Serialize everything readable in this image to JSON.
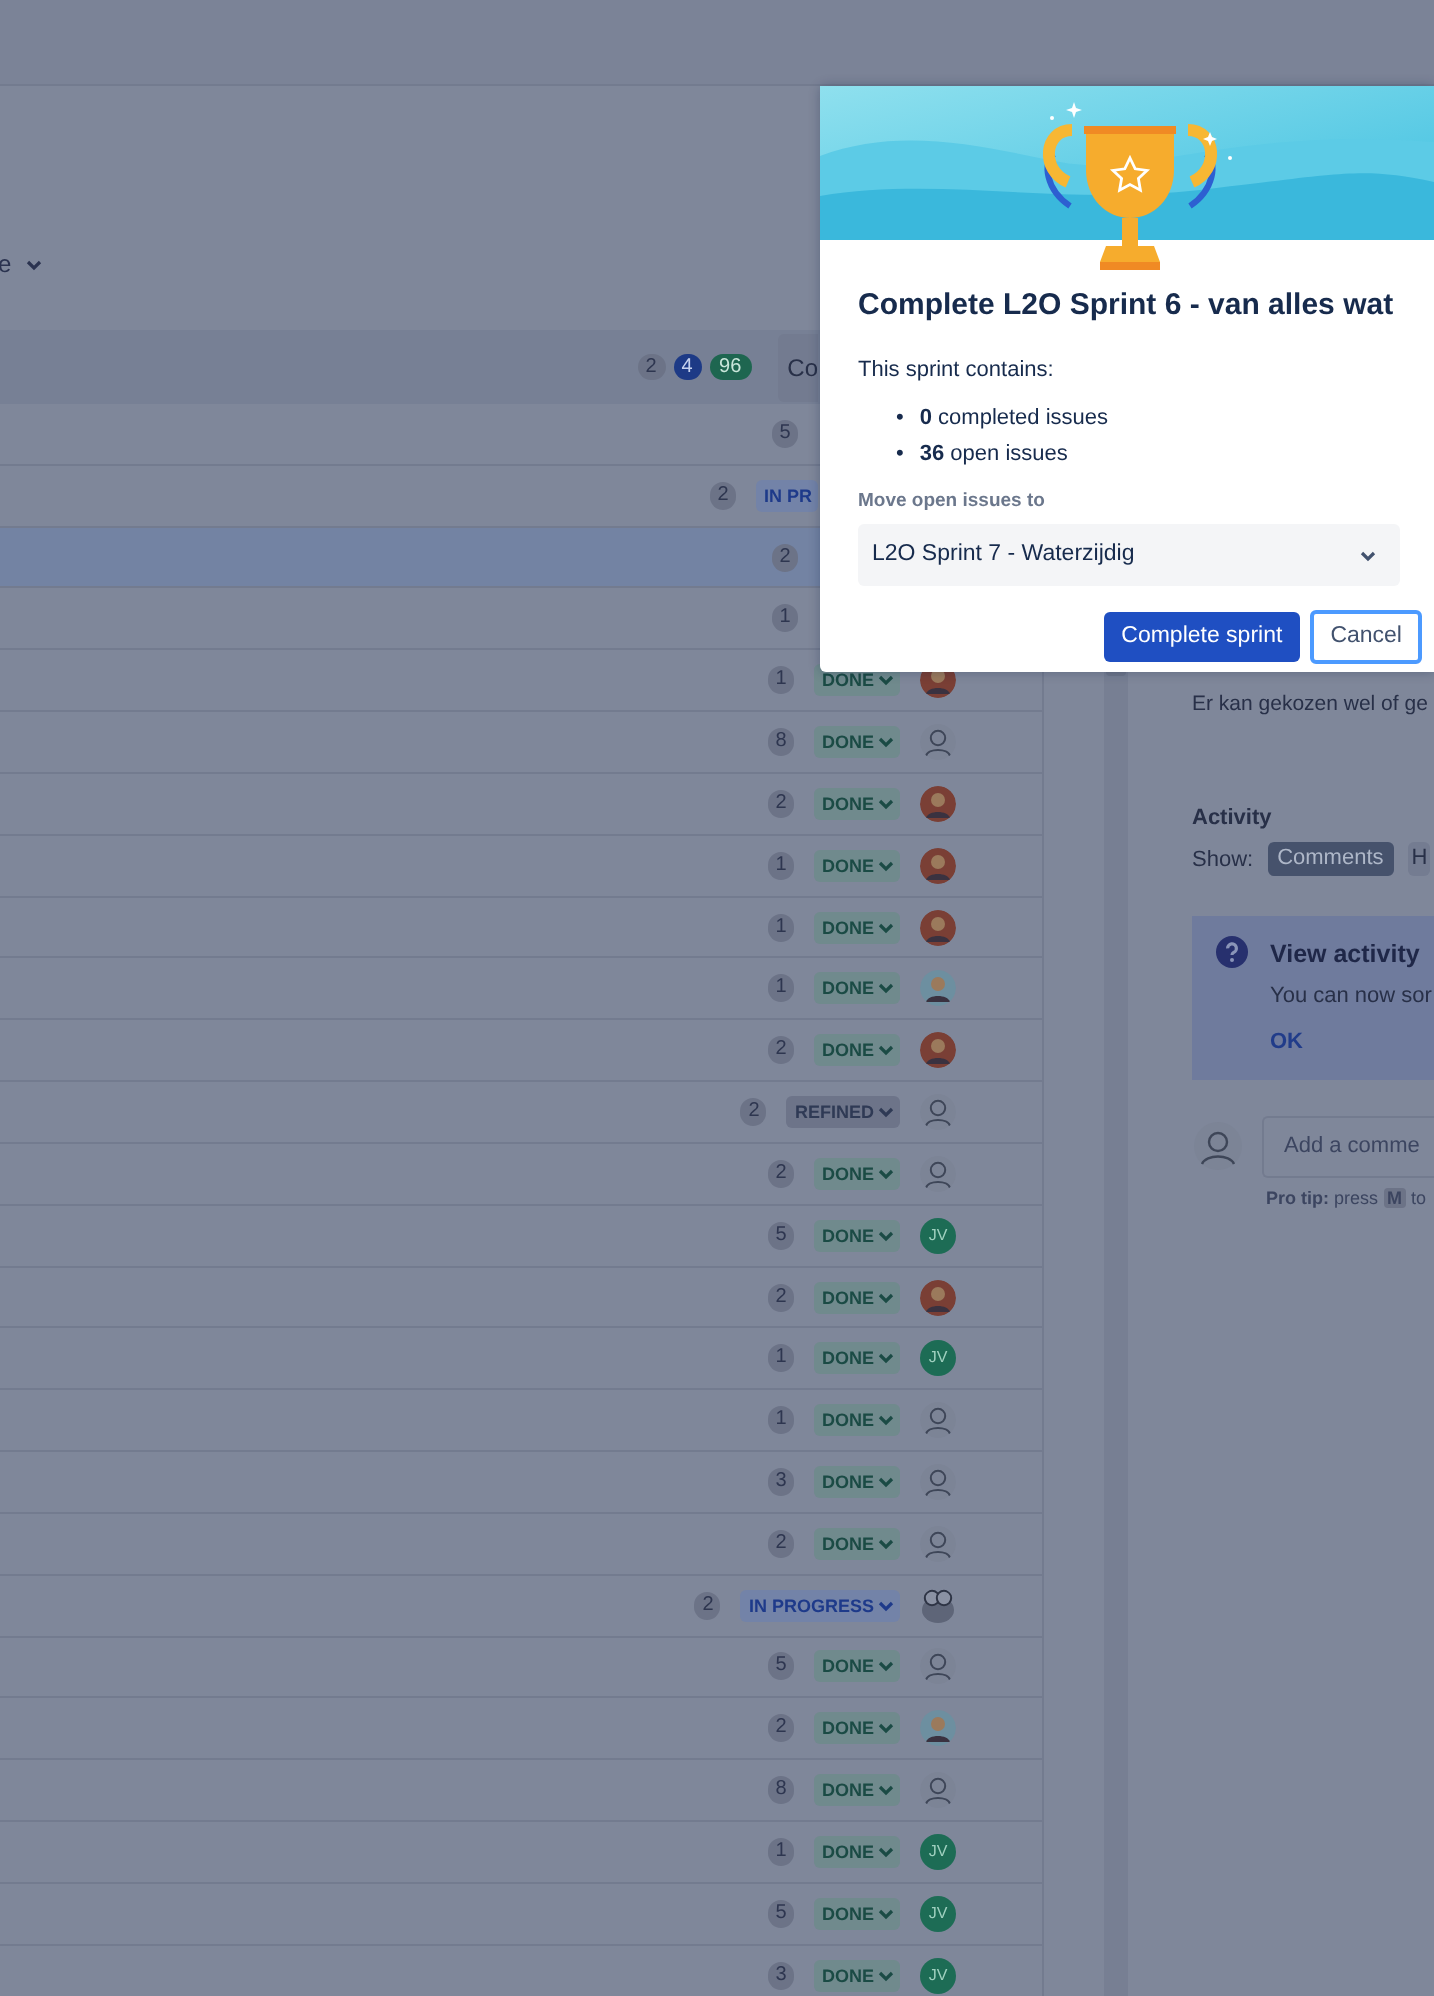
{
  "board": {
    "view_menu": {
      "label": "e"
    },
    "sprint_header": {
      "counts": [
        {
          "text": "2",
          "kind": "todo"
        },
        {
          "text": "4",
          "kind": "inprogress"
        },
        {
          "text": "96",
          "kind": "done"
        }
      ],
      "action": "Co"
    },
    "issues": [
      {
        "estimate": "5",
        "selected": false
      },
      {
        "estimate": "2",
        "selected": false,
        "status": "IN PR",
        "kind": "inprogress",
        "cut": true
      },
      {
        "estimate": "2",
        "selected": true
      },
      {
        "estimate": "1",
        "selected": false
      },
      {
        "estimate": "1",
        "selected": false,
        "status": "DONE",
        "kind": "done",
        "avatar": {
          "kind": "photo",
          "color": "#7a3f35"
        }
      },
      {
        "estimate": "8",
        "selected": false,
        "status": "DONE",
        "kind": "done",
        "avatar": {
          "kind": "default"
        }
      },
      {
        "estimate": "2",
        "selected": false,
        "status": "DONE",
        "kind": "done",
        "avatar": {
          "kind": "photo",
          "color": "#7a3f35"
        }
      },
      {
        "estimate": "1",
        "selected": false,
        "status": "DONE",
        "kind": "done",
        "avatar": {
          "kind": "photo",
          "color": "#7a3f35"
        }
      },
      {
        "estimate": "1",
        "selected": false,
        "status": "DONE",
        "kind": "done",
        "avatar": {
          "kind": "photo",
          "color": "#7a3f35"
        }
      },
      {
        "estimate": "1",
        "selected": false,
        "status": "DONE",
        "kind": "done",
        "avatar": {
          "kind": "photo",
          "color": "#6d8fa0"
        }
      },
      {
        "estimate": "2",
        "selected": false,
        "status": "DONE",
        "kind": "done",
        "avatar": {
          "kind": "photo",
          "color": "#7a3f35"
        }
      },
      {
        "estimate": "2",
        "selected": false,
        "status": "REFINED",
        "kind": "refined",
        "avatar": {
          "kind": "default"
        }
      },
      {
        "estimate": "2",
        "selected": false,
        "status": "DONE",
        "kind": "done",
        "avatar": {
          "kind": "default"
        }
      },
      {
        "estimate": "5",
        "selected": false,
        "status": "DONE",
        "kind": "done",
        "avatar": {
          "kind": "initials",
          "text": "JV"
        }
      },
      {
        "estimate": "2",
        "selected": false,
        "status": "DONE",
        "kind": "done",
        "avatar": {
          "kind": "photo",
          "color": "#7a3f35"
        }
      },
      {
        "estimate": "1",
        "selected": false,
        "status": "DONE",
        "kind": "done",
        "avatar": {
          "kind": "initials",
          "text": "JV"
        }
      },
      {
        "estimate": "1",
        "selected": false,
        "status": "DONE",
        "kind": "done",
        "avatar": {
          "kind": "default"
        }
      },
      {
        "estimate": "3",
        "selected": false,
        "status": "DONE",
        "kind": "done",
        "avatar": {
          "kind": "default"
        }
      },
      {
        "estimate": "2",
        "selected": false,
        "status": "DONE",
        "kind": "done",
        "avatar": {
          "kind": "default"
        }
      },
      {
        "estimate": "2",
        "selected": false,
        "status": "IN PROGRESS",
        "kind": "inprogress",
        "avatar": {
          "kind": "robot"
        }
      },
      {
        "estimate": "5",
        "selected": false,
        "status": "DONE",
        "kind": "done",
        "avatar": {
          "kind": "default"
        }
      },
      {
        "estimate": "2",
        "selected": false,
        "status": "DONE",
        "kind": "done",
        "avatar": {
          "kind": "photo",
          "color": "#6d8fa0"
        }
      },
      {
        "estimate": "8",
        "selected": false,
        "status": "DONE",
        "kind": "done",
        "avatar": {
          "kind": "default"
        }
      },
      {
        "estimate": "1",
        "selected": false,
        "status": "DONE",
        "kind": "done",
        "avatar": {
          "kind": "initials",
          "text": "JV"
        }
      },
      {
        "estimate": "5",
        "selected": false,
        "status": "DONE",
        "kind": "done",
        "avatar": {
          "kind": "initials",
          "text": "JV"
        }
      },
      {
        "estimate": "3",
        "selected": false,
        "status": "DONE",
        "kind": "done",
        "avatar": {
          "kind": "initials",
          "text": "JV"
        }
      }
    ]
  },
  "detail": {
    "description": "Er kan gekozen wel of ge",
    "activity_title": "Activity",
    "show_label": "Show:",
    "filters": [
      {
        "label": "Comments",
        "selected": true
      },
      {
        "label": "H",
        "selected": false
      }
    ],
    "tip": {
      "title": "View activity",
      "text": "You can now sor",
      "action": "OK"
    },
    "comment": {
      "placeholder": "Add a comme"
    },
    "pro_tip": {
      "label": "Pro tip:",
      "text": "press",
      "key": "M",
      "after": "to"
    }
  },
  "dialog": {
    "title": "Complete L2O Sprint 6 - van alles wat",
    "intro": "This sprint contains:",
    "stats": [
      {
        "marker": "•",
        "text": "**0** completed issues"
      },
      {
        "marker": "•",
        "text": "**36** open issues"
      }
    ],
    "move_label": "Move open issues to",
    "target": "L2O Sprint 7 - Waterzijdig",
    "buttons": [
      {
        "label": "Complete sprint",
        "kind": "primary"
      },
      {
        "label": "Cancel",
        "kind": "secondary"
      }
    ]
  }
}
